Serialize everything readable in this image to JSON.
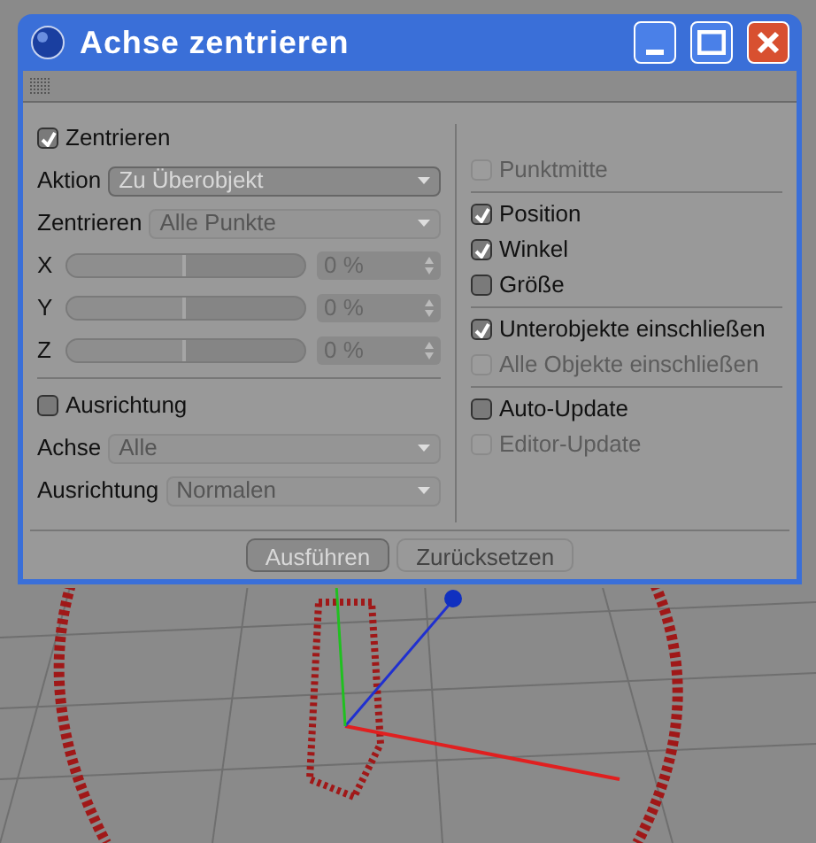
{
  "window": {
    "title": "Achse zentrieren"
  },
  "left": {
    "center": {
      "label": "Zentrieren",
      "checked": true
    },
    "center_fields": [
      {
        "label": "Aktion",
        "value": "Zu Überobjekt",
        "disabled": true
      },
      {
        "label": "Zentrieren",
        "value": "Alle Punkte",
        "disabled": false
      }
    ],
    "axes": [
      {
        "label": "X",
        "level": 0.5,
        "value": "0 %"
      },
      {
        "label": "Y",
        "level": 0.5,
        "value": "0 %"
      },
      {
        "label": "Z",
        "level": 0.5,
        "value": "0 %"
      }
    ],
    "align": {
      "label": "Ausrichtung",
      "checked": false
    },
    "align_fields": [
      {
        "label": "Achse",
        "value": "Alle",
        "disabled": false
      },
      {
        "label": "Ausrichtung",
        "value": "Normalen",
        "disabled": false
      }
    ]
  },
  "right": [
    [
      {
        "label": "Punktmitte",
        "checked": false,
        "disabled": true
      }
    ],
    [
      {
        "label": "Position",
        "checked": true,
        "disabled": false
      },
      {
        "label": "Winkel",
        "checked": true,
        "disabled": false
      },
      {
        "label": "Größe",
        "checked": false,
        "disabled": false
      }
    ],
    [
      {
        "label": "Unterobjekte einschließen",
        "checked": true,
        "disabled": false
      },
      {
        "label": "Alle Objekte einschließen",
        "checked": false,
        "disabled": true
      }
    ],
    [
      {
        "label": "Auto-Update",
        "checked": false,
        "disabled": false
      },
      {
        "label": "Editor-Update",
        "checked": false,
        "disabled": true
      }
    ]
  ],
  "buttons": [
    {
      "label": "Ausführen",
      "disabled": true
    },
    {
      "label": "Zurücksetzen",
      "disabled": false
    }
  ]
}
